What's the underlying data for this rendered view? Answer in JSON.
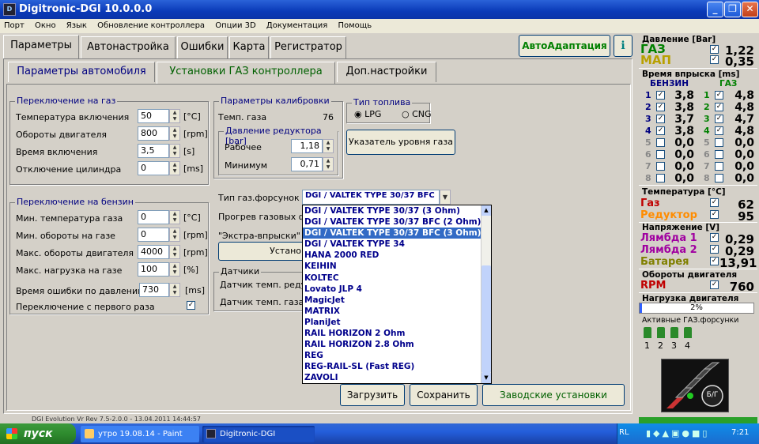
{
  "window": {
    "title": "Digitronic-DGI  10.0.0.0",
    "icon_text": "D"
  },
  "menu": [
    "Порт",
    "Окно",
    "Язык",
    "Обновление контроллера",
    "Опции 3D",
    "Документация",
    "Помощь"
  ],
  "tabs": [
    "Параметры",
    "Автонастройка",
    "Ошибки",
    "Карта",
    "Регистратор"
  ],
  "autoadapt_label": "АвтоАдаптация",
  "subtabs": [
    "Параметры автомобиля",
    "Установки ГАЗ контроллера",
    "Доп.настройки"
  ],
  "gas_switch": {
    "title": "Переключение на газ",
    "rows": [
      {
        "label": "Температура включения",
        "value": "50",
        "unit": "[°C]"
      },
      {
        "label": "Обороты двигателя",
        "value": "800",
        "unit": "[rpm]"
      },
      {
        "label": "Время включения",
        "value": "3,5",
        "unit": "[s]"
      },
      {
        "label": "Отключение цилиндра",
        "value": "0",
        "unit": "[ms]"
      }
    ]
  },
  "petrol_switch": {
    "title": "Переключение на бензин",
    "rows": [
      {
        "label": "Мин. температура газа",
        "value": "0",
        "unit": "[°C]"
      },
      {
        "label": "Мин. обороты на газе",
        "value": "0",
        "unit": "[rpm]"
      },
      {
        "label": "Макс. обороты двигателя",
        "value": "4000",
        "unit": "[rpm]"
      },
      {
        "label": "Макс. нагрузка на газе",
        "value": "100",
        "unit": "[%]"
      }
    ],
    "error_time_label": "Время ошибки по давлению",
    "error_time_value": "730",
    "error_time_unit": "[ms]",
    "first_time_label": "Переключение с первого раза",
    "first_time_check": "✓"
  },
  "calibration": {
    "title": "Параметры калибровки",
    "gas_temp_label": "Темп. газа",
    "gas_temp_value": "76",
    "pressure_title": "Давление редуктора [bar]",
    "working_label": "Рабочее",
    "working_value": "1,18",
    "min_label": "Минимум",
    "min_value": "0,71"
  },
  "fuel_type": {
    "title": "Тип топлива",
    "lpg": "LPG",
    "cng": "CNG"
  },
  "level_button": "Указатель уровня газа",
  "injectors": {
    "label": "Тип газ.форсунок",
    "selected": "DGI / VALTEK TYPE 30/37 BFC",
    "options": [
      "DGI / VALTEK TYPE 30/37 (3 Ohm)",
      "DGI / VALTEK TYPE 30/37 BFC (2 Ohm)",
      "DGI / VALTEK TYPE 30/37 BFC (3 Ohm)",
      "DGI / VALTEK TYPE 34",
      "HANA 2000 RED",
      "KEIHIN",
      "KOLTEC",
      "Lovato JLP 4",
      "MagicJet",
      "MATRIX",
      "PlaniJet",
      "RAIL HORIZON 2 Ohm",
      "RAIL HORIZON 2.8 Ohm",
      "REG",
      "REG-RAIL-SL (Fast REG)",
      "ZAVOLI"
    ],
    "selected_index": 2
  },
  "warmup_label": "Прогрев газовых ф",
  "extra_label": "\"Экстра-впрыски\"",
  "install_button": "Устано",
  "sensors": {
    "title": "Датчики",
    "sensor1": "Датчик темп. реду",
    "sensor2": "Датчик темп. газа"
  },
  "buttons": {
    "load": "Загрузить",
    "save": "Сохранить",
    "factory": "Заводские установки"
  },
  "right": {
    "pressure_title": "Давление [Bar]",
    "gas_label": "ГАЗ",
    "gas_value": "1,22",
    "map_label": "МАП",
    "map_value": "0,35",
    "inj_title": "Время впрыска [ms]",
    "petrol_head": "БЕНЗИН",
    "gas_head": "ГАЗ",
    "inj_rows": [
      {
        "n": "1",
        "p": "3,8",
        "g": "4,8",
        "on": true
      },
      {
        "n": "2",
        "p": "3,8",
        "g": "4,8",
        "on": true
      },
      {
        "n": "3",
        "p": "3,7",
        "g": "4,7",
        "on": true
      },
      {
        "n": "4",
        "p": "3,8",
        "g": "4,8",
        "on": true
      },
      {
        "n": "5",
        "p": "0,0",
        "g": "0,0",
        "on": false
      },
      {
        "n": "6",
        "p": "0,0",
        "g": "0,0",
        "on": false
      },
      {
        "n": "7",
        "p": "0,0",
        "g": "0,0",
        "on": false
      },
      {
        "n": "8",
        "p": "0,0",
        "g": "0,0",
        "on": false
      }
    ],
    "temp_title": "Температура [°C]",
    "temp_gas_label": "Газ",
    "temp_gas_value": "62",
    "temp_red_label": "Редуктор",
    "temp_red_value": "95",
    "volt_title": "Напряжение [V]",
    "lambda1_label": "Лямбда 1",
    "lambda1_value": "0,29",
    "lambda2_label": "Лямбда 2",
    "lambda2_value": "0,29",
    "battery_label": "Батарея",
    "battery_value": "13,91",
    "rpm_title": "Обороты двигателя",
    "rpm_label": "RPM",
    "rpm_value": "760",
    "load_title": "Нагрузка двигателя",
    "load_value": "2%",
    "active_inj_title": "Активные ГАЗ.форсунки",
    "active_inj": [
      "1",
      "2",
      "3",
      "4"
    ],
    "bg_label": "Б/Г"
  },
  "status_text": "DGI Evolution Vr Rev 7.5-2.0.0 - 13.04.2011 14:44:57",
  "taskbar": {
    "start": "пуск",
    "tasks": [
      "утро 19.08.14 - Paint",
      "Digitronic-DGI"
    ],
    "lang": "RL",
    "clock": "7:21"
  },
  "colors": {
    "accent_blue": "#000080",
    "gas_green": "#008000",
    "map_yellow": "#b8a000",
    "red": "#c00000",
    "lambda_purple": "#a000a0",
    "battery_olive": "#808000"
  }
}
